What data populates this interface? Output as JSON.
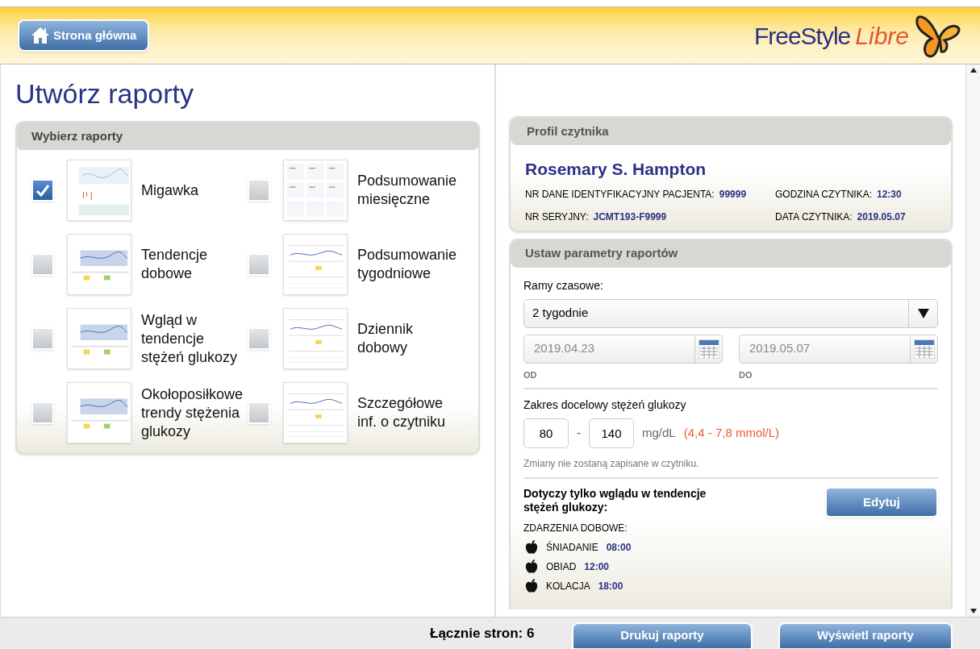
{
  "header": {
    "home_button": "Strona główna",
    "logo": {
      "brand": "FreeStyle",
      "product": "Libre"
    }
  },
  "page_title": "Utwórz raporty",
  "reports_panel": {
    "title": "Wybierz raporty",
    "reports": [
      {
        "label": "Migawka",
        "checked": true
      },
      {
        "label": "Tendencje dobowe",
        "checked": false
      },
      {
        "label": "Wgląd w tendencje stężeń glukozy",
        "checked": false
      },
      {
        "label": "Okołoposiłkowe trendy stężenia glukozy",
        "checked": false
      },
      {
        "label": "Podsumowanie miesięczne",
        "checked": false
      },
      {
        "label": "Podsumowanie tygodniowe",
        "checked": false
      },
      {
        "label": "Dziennik dobowy",
        "checked": false
      },
      {
        "label": "Szczegółowe inf. o czytniku",
        "checked": false
      }
    ]
  },
  "profile": {
    "title": "Profil czytnika",
    "name": "Rosemary S. Hampton",
    "fields": [
      {
        "label": "NR DANE IDENTYFIKACYJNY PACJENTA:",
        "value": "99999"
      },
      {
        "label": "GODZINA CZYTNIKA:",
        "value": "12:30"
      },
      {
        "label": "NR SERYJNY:",
        "value": "JCMT193-F9999"
      },
      {
        "label": "DATA CZYTNIKA:",
        "value": "2019.05.07"
      }
    ]
  },
  "parameters": {
    "title": "Ustaw parametry raportów",
    "timeframe_label": "Ramy czasowe:",
    "timeframe": "2 tygodnie",
    "dates": [
      {
        "value": "2019.04.23",
        "label": "OD"
      },
      {
        "value": "2019.05.07",
        "label": "DO"
      }
    ],
    "target_label": "Zakres docelowy stężeń glukozy",
    "target_low": "80",
    "separator": "-",
    "target_high": "140",
    "unit": "mg/dL",
    "mmol": "(4,4 - 7,8 mmol/L)",
    "note": "Zmiany nie zostaną zapisane w czytniku.",
    "insight_title": "Dotyczy tylko wglądu w tendencje stężeń glukozy:",
    "edit_button": "Edytuj",
    "events_label": "ZDARZENIA DOBOWE:",
    "events": [
      {
        "kind": "meal",
        "label": "ŚNIADANIE",
        "time": "08:00"
      },
      {
        "kind": "meal",
        "label": "OBIAD",
        "time": "12:00"
      },
      {
        "kind": "meal",
        "label": "KOLACJA",
        "time": "18:00"
      }
    ]
  },
  "footer": {
    "total_pages": "Łącznie stron: 6",
    "print_button": "Drukuj raporty",
    "view_button": "Wyświetl raporty"
  }
}
